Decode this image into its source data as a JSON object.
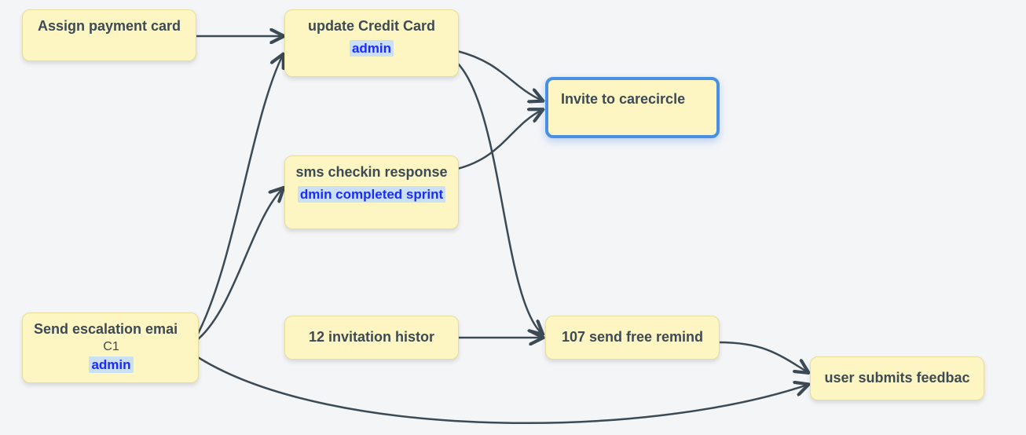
{
  "nodes": {
    "assign_payment": {
      "title": "Assign payment card"
    },
    "update_credit": {
      "title": "update Credit Card",
      "tag": "admin"
    },
    "invite_carecircle": {
      "title": "Invite to carecircle"
    },
    "sms_checkin": {
      "title": "sms checkin response",
      "tag": "dmin completed sprint"
    },
    "send_escalation": {
      "title": "Send escalation emai",
      "sub": "C1",
      "tag": "admin"
    },
    "invitation_histor": {
      "title": "12 invitation histor"
    },
    "send_free_remind": {
      "title": "107 send free remind"
    },
    "user_feedback": {
      "title": "user submits feedbac"
    }
  }
}
